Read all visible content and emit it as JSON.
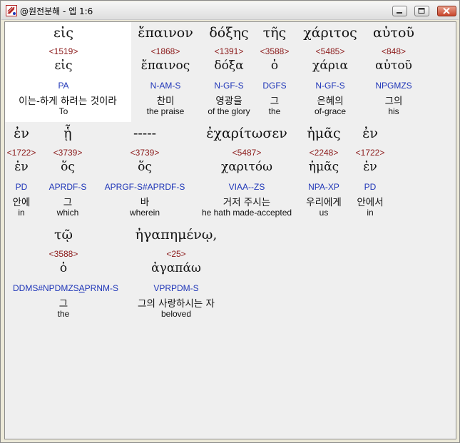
{
  "window": {
    "title": "@원전분해 - 엡 1:6",
    "accent_close": "#c9462c"
  },
  "rows": [
    {
      "words": [
        {
          "greek": "εἰς",
          "strong": "<1519>",
          "lemma": "εἰς",
          "morph": "PA",
          "korean": "이는-하게 하려는 것이라",
          "english": "To"
        },
        {
          "greek": "ἔπαινον",
          "strong": "<1868>",
          "lemma": "ἔπαινος",
          "morph": "N-AM-S",
          "korean": "찬미",
          "english": "the praise"
        },
        {
          "greek": "δόξης",
          "strong": "<1391>",
          "lemma": "δόξα",
          "morph": "N-GF-S",
          "korean": "영광을",
          "english": "of the glory"
        },
        {
          "greek": "τῆς",
          "strong": "<3588>",
          "lemma": "ὁ",
          "morph": "DGFS",
          "korean": "그",
          "english": "the"
        },
        {
          "greek": "χάριτος",
          "strong": "<5485>",
          "lemma": "χάρια",
          "morph": "N-GF-S",
          "korean": "은혜의",
          "english": "of-grace"
        },
        {
          "greek": "αὐτοῦ",
          "strong": "<848>",
          "lemma": "αὐτοῦ",
          "morph": "NPGMZS",
          "korean": "그의",
          "english": "his"
        }
      ]
    },
    {
      "words": [
        {
          "greek": "ἐν",
          "strong": "<1722>",
          "lemma": "ἐν",
          "morph": "PD",
          "korean": "안에",
          "english": "in"
        },
        {
          "greek": "ᾗ",
          "strong": "<3739>",
          "lemma": "ὅς",
          "morph": "APRDF-S",
          "korean": "그",
          "english": "which"
        },
        {
          "greek": "-----",
          "strong": "<3739>",
          "lemma": "ὅς",
          "morph": "APRGF-S#APRDF-S",
          "korean": "바",
          "english": "wherein"
        },
        {
          "greek": "ἐχαρίτωσεν",
          "strong": "<5487>",
          "lemma": "χαριτόω",
          "morph": "VIAA--ZS",
          "korean": "거저 주시는",
          "english": "he hath made-accepted"
        },
        {
          "greek": "ἡμᾶς",
          "strong": "<2248>",
          "lemma": "ἡμᾶς",
          "morph": "NPA-XP",
          "korean": "우리에게",
          "english": "us"
        },
        {
          "greek": "ἐν",
          "strong": "<1722>",
          "lemma": "ἐν",
          "morph": "PD",
          "korean": "안에서",
          "english": "in"
        }
      ]
    },
    {
      "words": [
        {
          "greek": "τῷ",
          "strong": "<3588>",
          "lemma": "ὁ",
          "morph": "DDMS#NPDMZSAPRNM-S",
          "korean": "그",
          "english": "the"
        },
        {
          "greek": "ἠγαπημένῳ,",
          "strong": "<25>",
          "lemma": "ἀγαπάω",
          "morph": "VPRPDM-S",
          "korean": "그의 사랑하시는 자",
          "english": "beloved"
        }
      ]
    }
  ]
}
